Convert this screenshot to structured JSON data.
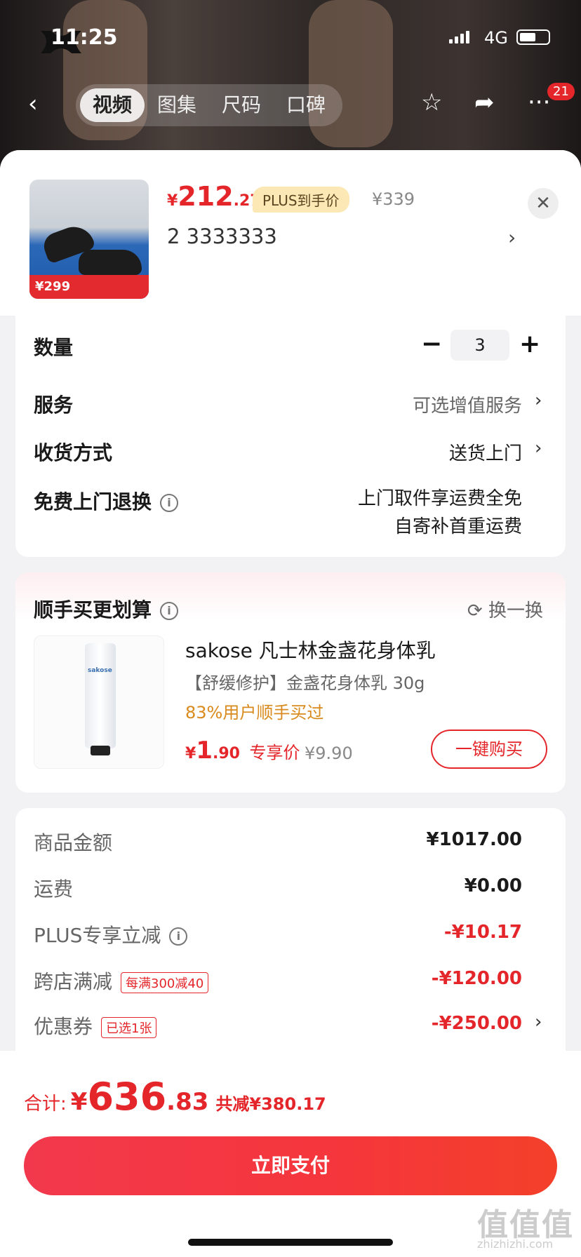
{
  "status": {
    "time": "11:25",
    "network": "4G"
  },
  "nav": {
    "tabs": [
      "视频",
      "图集",
      "尺码",
      "口碑"
    ],
    "cart_badge": "21"
  },
  "product": {
    "price_currency": "¥",
    "price_int": "212",
    "price_dec": ".27",
    "plus_tag": "PLUS到手价",
    "orig_price": "¥339",
    "spec": "2  3333333",
    "thumb_price": "299"
  },
  "options": {
    "quantity_label": "数量",
    "quantity_value": "3",
    "minus": "−",
    "plus": "+",
    "service_label": "服务",
    "service_value": "可选增值服务",
    "delivery_label": "收货方式",
    "delivery_value": "送货上门",
    "return_label": "免费上门退换",
    "return_line1": "上门取件享运费全免",
    "return_line2": "自寄补首重运费"
  },
  "addon": {
    "title": "顺手买更划算",
    "refresh": "换一换",
    "name": "sakose 凡士林金盏花身体乳",
    "desc": "【舒缓修护】金盏花身体乳 30g",
    "bought": "83%用户顺手买过",
    "price_currency": "¥",
    "price_int": "1",
    "price_dec": ".90",
    "price_tag": "专享价",
    "orig_price": "¥9.90",
    "buy_label": "一键购买",
    "brand_on_tube": "sakose"
  },
  "summary": {
    "goods_label": "商品金额",
    "goods_value": "¥1017.00",
    "freight_label": "运费",
    "freight_value": "¥0.00",
    "plus_label": "PLUS专享立减",
    "plus_value": "-¥10.17",
    "cross_label": "跨店满减",
    "cross_tag": "每满300减40",
    "cross_value": "-¥120.00",
    "coupon_label": "优惠券",
    "coupon_tag": "已选1张",
    "coupon_value": "-¥250.00"
  },
  "total": {
    "label": "合计:",
    "currency": "¥",
    "int": "636",
    "dec": ".83",
    "saved": "共减¥380.17"
  },
  "pay_label": "立即支付",
  "watermark": {
    "main": "值值值",
    "sub": "zhizhizhi.com"
  },
  "colors": {
    "accent": "#e4262b",
    "plus_tag_bg": "#fbe8b5"
  }
}
